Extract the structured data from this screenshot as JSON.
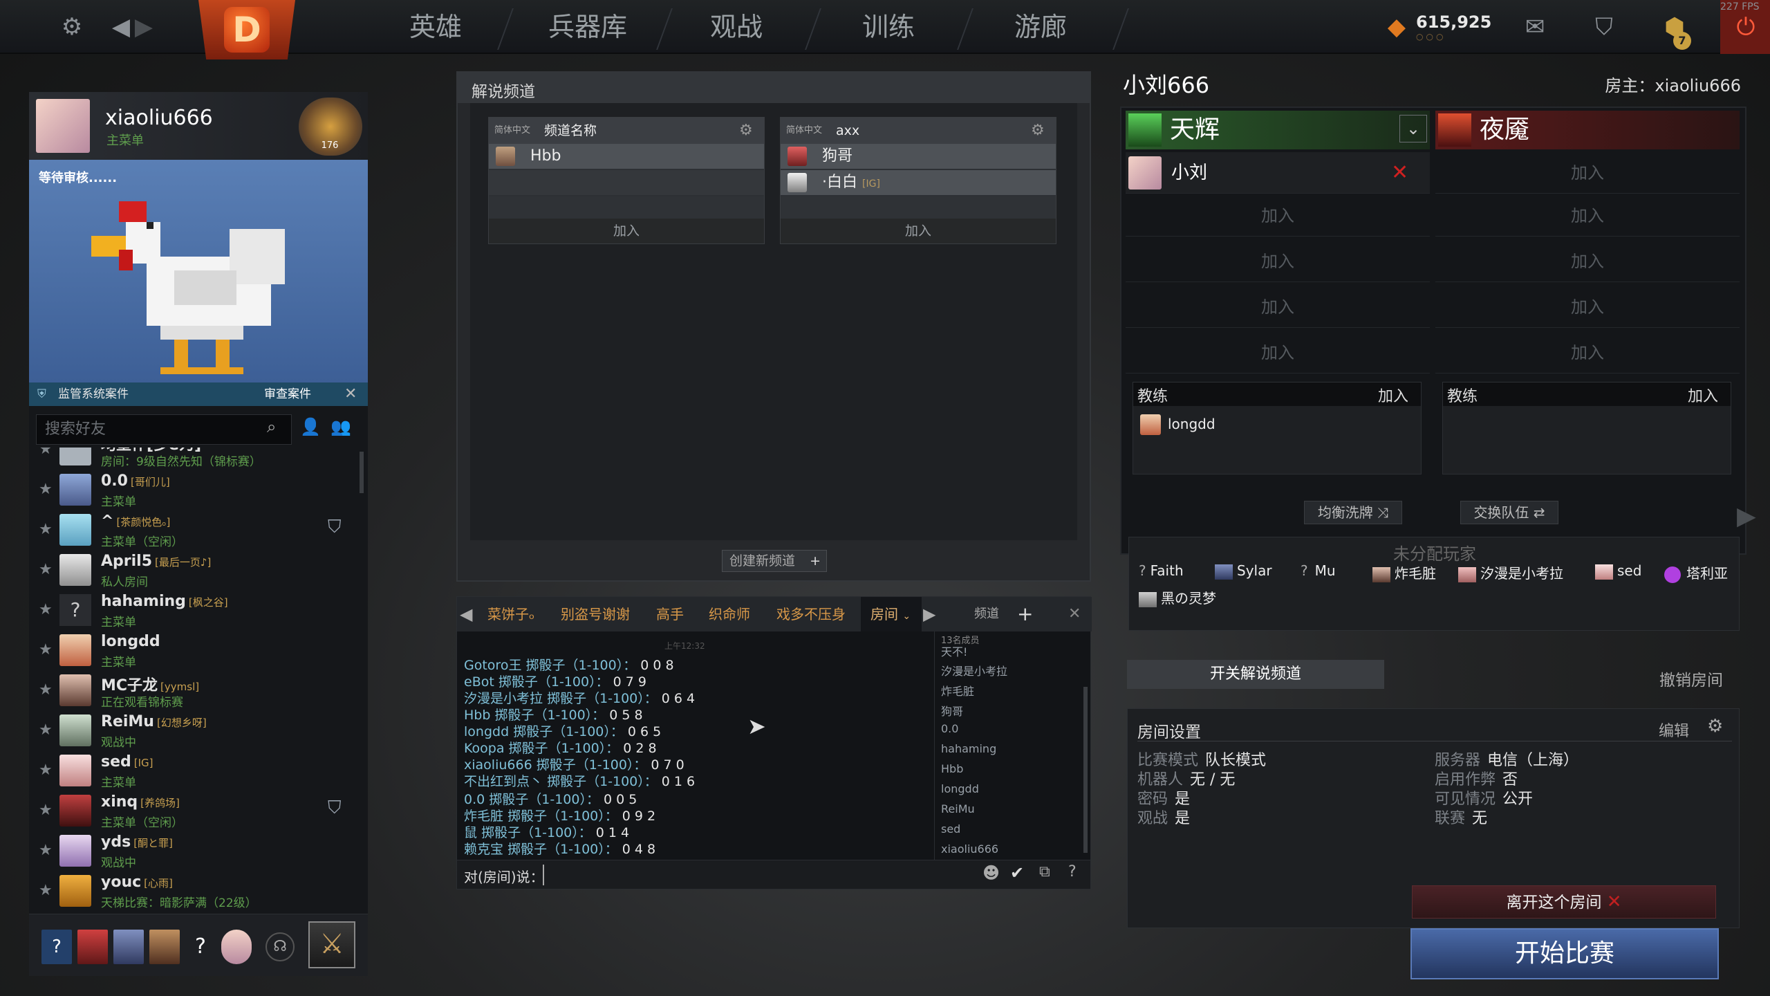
{
  "topbar": {
    "nav": [
      "英雄",
      "兵器库",
      "观战",
      "训练",
      "游廊"
    ],
    "gold": "615,925",
    "fps": "227 FPS",
    "level_badge": "7"
  },
  "icons": [
    "gear-icon",
    "back-arrow-icon",
    "forward-arrow-icon",
    "dota-logo-icon",
    "gold-icon",
    "mail-icon",
    "armory-icon",
    "shield-level-icon",
    "power-icon"
  ],
  "profile": {
    "name": "xiaoliu666",
    "status": "主菜单",
    "rank": "176"
  },
  "showcase": {
    "pending": "等待审核......"
  },
  "report": {
    "label": "监管系统案件",
    "button": "审查案件"
  },
  "friends_search": {
    "placeholder": "搜索好友"
  },
  "friends": [
    {
      "name": "均墨作[多e为]",
      "tag": "",
      "sub": "房间：9级自然先知（锦标赛）"
    },
    {
      "name": "0.0",
      "tag": "[哥们儿]",
      "sub": "主菜单"
    },
    {
      "name": "^",
      "tag": "[茶颜悦色ₒ]",
      "sub": "主菜单（空闲）"
    },
    {
      "name": "April5",
      "tag": "[最后一页♪]",
      "sub": "私人房间"
    },
    {
      "name": "hahaming",
      "tag": "[枫之谷]",
      "sub": "主菜单"
    },
    {
      "name": "longdd",
      "tag": "",
      "sub": "主菜单"
    },
    {
      "name": "MC子龙",
      "tag": "[yymsl]",
      "sub": "正在观看锦标赛"
    },
    {
      "name": "ReiMu",
      "tag": "[幻想乡呀]",
      "sub": "观战中"
    },
    {
      "name": "sed",
      "tag": "[IG]",
      "sub": "主菜单"
    },
    {
      "name": "xinq",
      "tag": "[养鸽场]",
      "sub": "主菜单（空闲）"
    },
    {
      "name": "yds",
      "tag": "[酮と罪]",
      "sub": "观战中"
    },
    {
      "name": "youc",
      "tag": "[心雨]",
      "sub": "天梯比赛：暗影萨满（22级）"
    }
  ],
  "broadcast": {
    "title": "解说频道",
    "create": "创建新频道",
    "channels": [
      {
        "lang": "简体中文",
        "name": "频道名称",
        "members": [
          "Hbb"
        ],
        "join": "加入"
      },
      {
        "lang": "简体中文",
        "name": "axx",
        "members": [
          "狗哥",
          "·白白"
        ],
        "tags": [
          "",
          "[IG]"
        ],
        "join": "加入"
      }
    ]
  },
  "chat": {
    "tabs": [
      "菜饼子ₒ",
      "别盗号谢谢",
      "高手",
      "织命师",
      "戏多不压身",
      "房间"
    ],
    "channels_label": "频道",
    "time": "上午12:32",
    "member_count": "13名成员",
    "input_label": "对(房间)说：",
    "messages": [
      [
        "Gotoro王",
        "掷骰子（1-100）：",
        "0 0 8"
      ],
      [
        "eBot",
        "掷骰子（1-100）：",
        "0 7 9"
      ],
      [
        "汐漫是小考拉",
        "掷骰子（1-100）：",
        "0 6 4"
      ],
      [
        "Hbb",
        "掷骰子（1-100）：",
        "0 5 8"
      ],
      [
        "longdd",
        "掷骰子（1-100）：",
        "0 6 5"
      ],
      [
        "Koopa",
        "掷骰子（1-100）：",
        "0 2 8"
      ],
      [
        "xiaoliu666",
        "掷骰子（1-100）：",
        "0 7 0"
      ],
      [
        "不出红到点丶",
        "掷骰子（1-100）：",
        "0 1 6"
      ],
      [
        "0.0",
        "掷骰子（1-100）：",
        "0 0 5"
      ],
      [
        "炸毛脏",
        "掷骰子（1-100）：",
        "0 9 2"
      ],
      [
        "鼠",
        "掷骰子（1-100）：",
        "0 1 4"
      ],
      [
        "赖克宝",
        "掷骰子（1-100）：",
        "0 4 8"
      ]
    ],
    "members": [
      "天不!",
      "汐漫是小考拉",
      "炸毛脏",
      "狗哥",
      "0.0",
      "hahaming",
      "Hbb",
      "longdd",
      "ReiMu",
      "sed",
      "xiaoliu666"
    ]
  },
  "lobby": {
    "title": "小刘666",
    "host_label": "房主：xiaoliu666",
    "radiant": {
      "name": "天辉",
      "player": "小刘",
      "join": "加入"
    },
    "dire": {
      "name": "夜魇",
      "join": "加入"
    },
    "coach_label": "教练",
    "coach_join": "加入",
    "radiant_coach": "longdd",
    "shuffle": "均衡洗牌",
    "swap": "交换队伍",
    "unassigned_title": "未分配玩家",
    "unassigned": [
      "Faith",
      "Sylar",
      "Mu",
      "炸毛脏",
      "汐漫是小考拉",
      "sed",
      "塔利亚",
      "黑の灵梦"
    ],
    "toggle_broadcast": "开关解说频道",
    "cancel_room": "撤销房间",
    "settings_title": "房间设置",
    "edit": "编辑",
    "settings": [
      [
        "比赛模式",
        "队长模式"
      ],
      [
        "机器人",
        "无 / 无"
      ],
      [
        "密码",
        "是"
      ],
      [
        "观战",
        "是"
      ],
      [
        "服务器",
        "电信（上海）"
      ],
      [
        "启用作弊",
        "否"
      ],
      [
        "可见情况",
        "公开"
      ],
      [
        "联赛",
        "无"
      ]
    ],
    "leave": "离开这个房间",
    "start": "开始比赛"
  }
}
